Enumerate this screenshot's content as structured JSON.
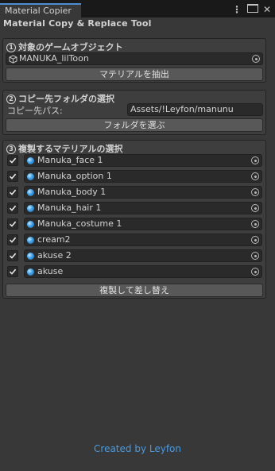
{
  "window": {
    "tab_title": "Material Copier",
    "tool_title": "Material Copy & Replace Tool"
  },
  "section1": {
    "number": "1",
    "title": "対象のゲームオブジェクト",
    "object_field": "MANUKA_lilToon",
    "extract_button": "マテリアルを抽出"
  },
  "section2": {
    "number": "2",
    "title": "コピー先フォルダの選択",
    "path_label": "コピー先パス:",
    "path_value": "Assets/!Leyfon/manunu",
    "choose_button": "フォルダを選ぶ"
  },
  "section3": {
    "number": "3",
    "title": "複製するマテリアルの選択",
    "materials": [
      {
        "name": "Manuka_face 1",
        "checked": true
      },
      {
        "name": "Manuka_option 1",
        "checked": true
      },
      {
        "name": "Manuka_body 1",
        "checked": true
      },
      {
        "name": "Manuka_hair 1",
        "checked": true
      },
      {
        "name": "Manuka_costume 1",
        "checked": true
      },
      {
        "name": "cream2",
        "checked": true
      },
      {
        "name": "akuse 2",
        "checked": true
      },
      {
        "name": "akuse",
        "checked": true
      }
    ],
    "replace_button": "複製して差し替え"
  },
  "footer": {
    "credit": "Created by Leyfon"
  },
  "icons": {
    "kebab": "more-vert-icon",
    "maximize": "maximize-icon",
    "close": "close-icon",
    "object": "gameobject-cube-icon",
    "material": "material-sphere-icon",
    "picker": "object-picker-icon",
    "checkmark": "checkmark-icon"
  },
  "colors": {
    "accent_tab": "#4d8dd0",
    "credit_link": "#4a9ae0"
  }
}
